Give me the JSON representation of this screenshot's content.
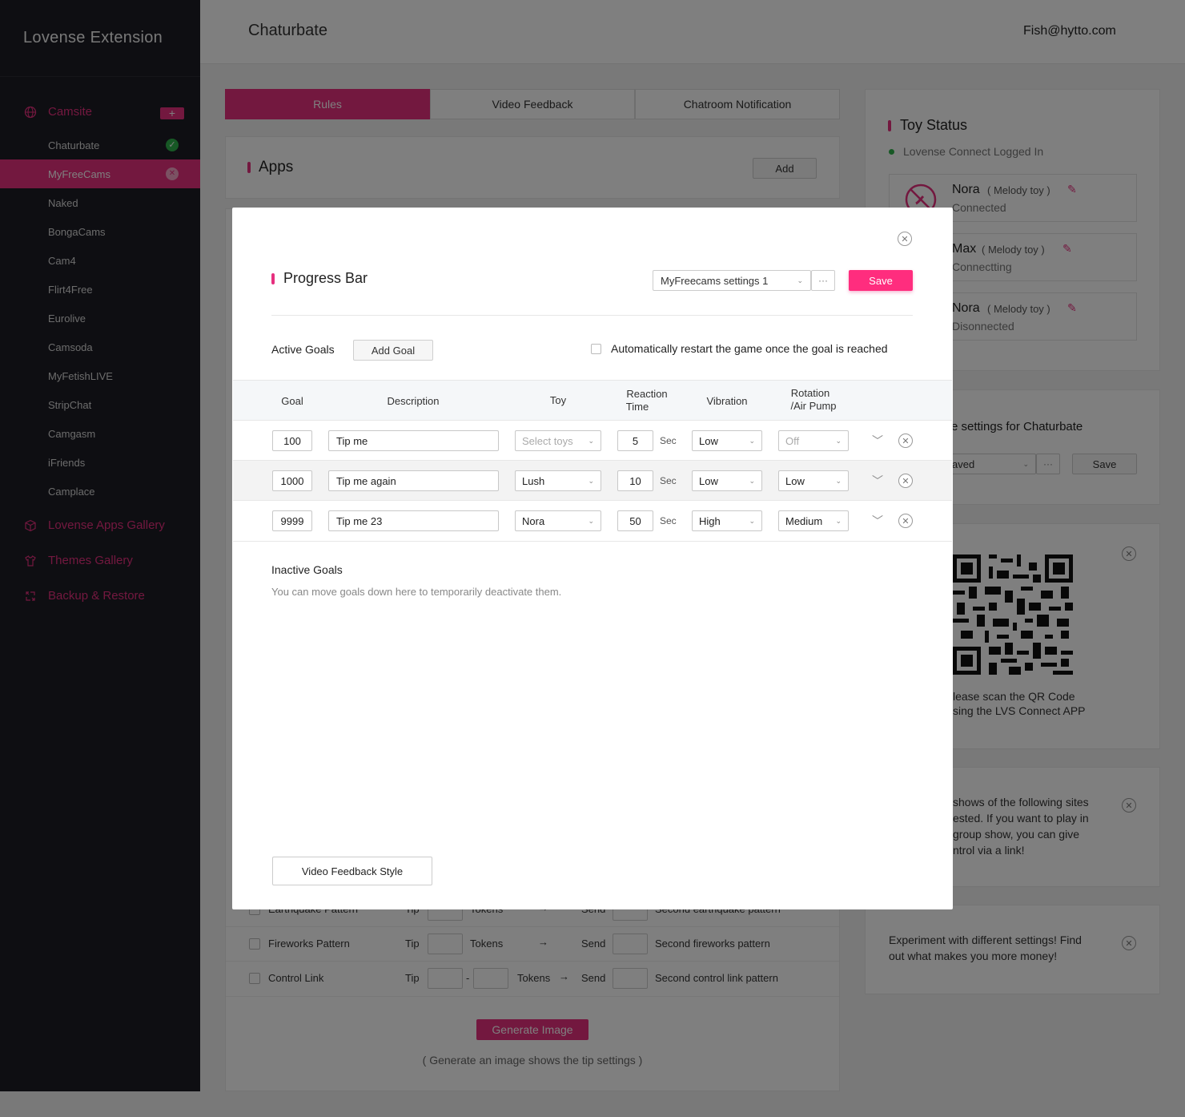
{
  "sidebar": {
    "title": "Lovense Extension",
    "camsite_label": "Camsite",
    "plus": "+",
    "sites": [
      "Chaturbate",
      "MyFreeCams",
      "Naked",
      "BongaCams",
      "Cam4",
      "Flirt4Free",
      "Eurolive",
      "Camsoda",
      "MyFetishLIVE",
      "StripChat",
      "Camgasm",
      "iFriends",
      "Camplace"
    ],
    "active_site": "MyFreeCams",
    "apps_gallery": "Lovense Apps Gallery",
    "themes_gallery": "Themes Gallery",
    "backup_restore": "Backup & Restore"
  },
  "header": {
    "title": "Chaturbate",
    "user": "Fish@hytto.com"
  },
  "tabs": [
    "Rules",
    "Video Feedback",
    "Chatroom Notification"
  ],
  "apps": {
    "title": "Apps",
    "add": "Add"
  },
  "toy_status": {
    "title": "Toy Status",
    "connect_status": "Lovense Connect Logged In",
    "toys": [
      {
        "name": "Nora",
        "type": "( Melody toy )",
        "status": "Connected"
      },
      {
        "name": "Max",
        "type": "( Melody toy )",
        "status": "Connectting"
      },
      {
        "name": "Nora",
        "type": "( Melody toy )",
        "status": "Disonnected"
      }
    ]
  },
  "settings_card": {
    "title": "e settings for Chaturbate",
    "select": "aved",
    "more": "···",
    "save": "Save"
  },
  "qr_card": {
    "line1": "lease scan the QR Code",
    "line2": "sing the LVS Connect APP"
  },
  "group_card": {
    "line1": "shows of the following sites",
    "line2": "ested. If you want to play in",
    "line3": "group show, you can give",
    "line4": "ntrol via a link!"
  },
  "tip_card": {
    "line1": "Experiment with different settings! Find",
    "line2": "out what makes you more money!"
  },
  "patterns": [
    {
      "label": "Earthquake Pattern",
      "tip": "Tip",
      "tokens": "Tokens",
      "send": "Send",
      "second": "Second earthquake pattern"
    },
    {
      "label": "Fireworks Pattern",
      "tip": "Tip",
      "tokens": "Tokens",
      "send": "Send",
      "second": "Second fireworks pattern"
    },
    {
      "label": "Control Link",
      "tip": "Tip",
      "dash": "-",
      "tokens": "Tokens",
      "send": "Send",
      "second": "Second control link pattern"
    }
  ],
  "generate": {
    "button": "Generate Image",
    "hint": "( Generate an image shows the tip settings )"
  },
  "modal": {
    "title": "Progress Bar",
    "preset": "MyFreecams settings 1",
    "more": "···",
    "save": "Save",
    "active_goals": "Active Goals",
    "add_goal": "Add Goal",
    "auto_restart": "Automatically restart the game once the goal is reached",
    "headers": {
      "goal": "Goal",
      "description": "Description",
      "toy": "Toy",
      "reaction_1": "Reaction",
      "reaction_2": "Time",
      "vibration": "Vibration",
      "rotation_1": "Rotation",
      "rotation_2": "/Air Pump"
    },
    "sec": "Sec",
    "rows": [
      {
        "goal": "100",
        "description": "Tip me",
        "toy": "Select toys",
        "time": "5",
        "vibration": "Low",
        "rotation": "Off"
      },
      {
        "goal": "1000",
        "description": "Tip me again",
        "toy": "Lush",
        "time": "10",
        "vibration": "Low",
        "rotation": "Low"
      },
      {
        "goal": "9999",
        "description": "Tip me 23",
        "toy": "Nora",
        "time": "50",
        "vibration": "High",
        "rotation": "Medium"
      }
    ],
    "inactive_title": "Inactive Goals",
    "inactive_hint": "You can move goals down here to temporarily deactivate them.",
    "video_style": "Video Feedback Style"
  },
  "colors": {
    "accent": "#e6307f",
    "sidebar": "#1c1c24",
    "success": "#2fb14b"
  }
}
